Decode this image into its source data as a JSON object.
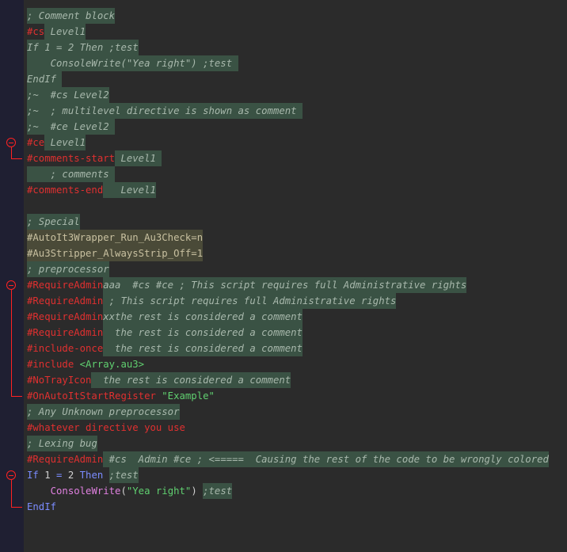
{
  "lines": [
    [
      {
        "t": "; Comment block",
        "c": "comment",
        "hl": "hl"
      }
    ],
    [
      {
        "t": "#cs",
        "c": "dir"
      },
      {
        "t": " Level1",
        "c": "comment",
        "hl": "hl"
      }
    ],
    [
      {
        "t": "If 1 = 2 Then ;test",
        "c": "comment",
        "hl": "hl"
      }
    ],
    [
      {
        "t": "    ConsoleWrite(\"Yea right\") ;test ",
        "c": "comment",
        "hl": "hl"
      }
    ],
    [
      {
        "t": "EndIf ",
        "c": "comment",
        "hl": "hl"
      }
    ],
    [
      {
        "t": ";~  #cs Level2",
        "c": "comment",
        "hl": "hl"
      }
    ],
    [
      {
        "t": ";~  ; multilevel directive is shown as comment ",
        "c": "comment",
        "hl": "hl"
      }
    ],
    [
      {
        "t": ";~  #ce Level2 ",
        "c": "comment",
        "hl": "hl"
      }
    ],
    [
      {
        "t": "#ce",
        "c": "dir"
      },
      {
        "t": " Level1",
        "c": "comment",
        "hl": "hl"
      }
    ],
    [
      {
        "t": "#comments-start",
        "c": "dir"
      },
      {
        "t": " Level1 ",
        "c": "comment",
        "hl": "hl"
      }
    ],
    [
      {
        "t": "    ; comments ",
        "c": "comment",
        "hl": "hl"
      }
    ],
    [
      {
        "t": "#comments-end",
        "c": "dir"
      },
      {
        "t": "   Level1",
        "c": "comment",
        "hl": "hl"
      }
    ],
    [],
    [
      {
        "t": "; Special",
        "c": "comment",
        "hl": "hl"
      }
    ],
    [
      {
        "t": "#AutoIt3Wrapper_Run_Au3Check=n",
        "c": "pre",
        "hl": "hl-y"
      }
    ],
    [
      {
        "t": "#Au3Stripper_AlwaysStrip_Off=1",
        "c": "pre",
        "hl": "hl-y"
      }
    ],
    [
      {
        "t": "; preprocessor",
        "c": "comment",
        "hl": "hl"
      }
    ],
    [
      {
        "t": "#RequireAdmin",
        "c": "dir"
      },
      {
        "t": "aaa  #cs #ce ; This script requires full Administrative rights",
        "c": "comment",
        "hl": "hl"
      }
    ],
    [
      {
        "t": "#RequireAdmin",
        "c": "dir"
      },
      {
        "t": " ; This script requires full Administrative rights",
        "c": "comment",
        "hl": "hl"
      }
    ],
    [
      {
        "t": "#RequireAdmin",
        "c": "dir"
      },
      {
        "t": "xxthe rest is considered a comment",
        "c": "comment",
        "hl": "hl"
      }
    ],
    [
      {
        "t": "#RequireAdmin",
        "c": "dir"
      },
      {
        "t": "  the rest is considered a comment",
        "c": "comment",
        "hl": "hl"
      }
    ],
    [
      {
        "t": "#include-once",
        "c": "dir"
      },
      {
        "t": "  the rest is considered a comment",
        "c": "comment",
        "hl": "hl"
      }
    ],
    [
      {
        "t": "#include ",
        "c": "dir"
      },
      {
        "t": "<Array.au3>",
        "c": "str"
      }
    ],
    [
      {
        "t": "#NoTrayIcon",
        "c": "dir"
      },
      {
        "t": "  the rest is considered a comment",
        "c": "comment",
        "hl": "hl"
      }
    ],
    [
      {
        "t": "#OnAutoItStartRegister ",
        "c": "dir"
      },
      {
        "t": "\"Example\"",
        "c": "str"
      }
    ],
    [
      {
        "t": "; Any Unknown preprocessor",
        "c": "comment",
        "hl": "hl"
      }
    ],
    [
      {
        "t": "#whatever directive you use",
        "c": "dir"
      }
    ],
    [
      {
        "t": "; Lexing bug",
        "c": "comment",
        "hl": "hl"
      }
    ],
    [
      {
        "t": "#RequireAdmin",
        "c": "dir"
      },
      {
        "t": " #cs  Admin #ce ; <=====  Causing the rest of the code to be wrongly colored",
        "c": "comment",
        "hl": "hl"
      }
    ],
    [
      {
        "t": "If ",
        "c": "blue"
      },
      {
        "t": "1",
        "c": "plain"
      },
      {
        "t": " = ",
        "c": "blue"
      },
      {
        "t": "2",
        "c": "plain"
      },
      {
        "t": " Then ",
        "c": "blue"
      },
      {
        "t": ";test",
        "c": "comment",
        "hl": "hl"
      }
    ],
    [
      {
        "t": "    ",
        "c": "plain"
      },
      {
        "t": "ConsoleWrite",
        "c": "func"
      },
      {
        "t": "(",
        "c": "plain"
      },
      {
        "t": "\"Yea right\"",
        "c": "str"
      },
      {
        "t": ") ",
        "c": "plain"
      },
      {
        "t": ";test",
        "c": "comment",
        "hl": "hl"
      }
    ],
    [
      {
        "t": "EndIf",
        "c": "blue"
      }
    ]
  ]
}
